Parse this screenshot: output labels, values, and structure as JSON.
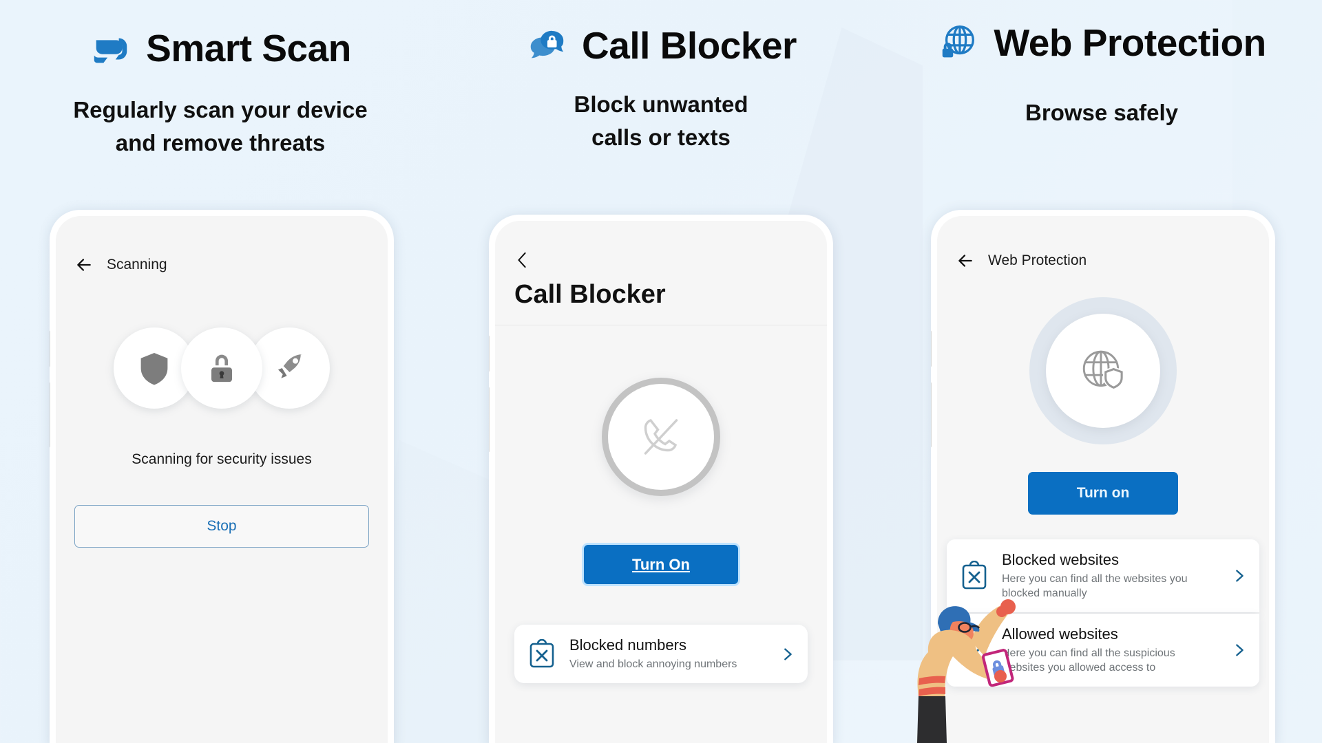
{
  "theme": {
    "page_bg": "#eaf4fc",
    "brand_blue": "#0a6fc2",
    "icon_blue": "#1f7bc4",
    "link_blue": "#1a6fb5",
    "heading_black": "#0a0a0a",
    "muted_gray": "#6f7478",
    "phone_screen": "#f5f5f5"
  },
  "panels": [
    {
      "id": "smart-scan",
      "header": {
        "icon": "smart-scan-icon",
        "title": "Smart Scan"
      },
      "subtitle": "Regularly scan your device and remove threats",
      "subtitle_lines": [
        "Regularly scan your device",
        "and remove threats"
      ],
      "phone": {
        "nav": {
          "back_icon": "arrow-left-icon",
          "title": "Scanning"
        },
        "status_icons": [
          "shield-icon",
          "lock-icon",
          "rocket-icon"
        ],
        "status_text": "Scanning for security issues",
        "primary_button": {
          "label": "Stop",
          "style": "outline"
        }
      }
    },
    {
      "id": "call-blocker",
      "header": {
        "icon": "chat-lock-icon",
        "title": "Call Blocker"
      },
      "subtitle": "Block unwanted calls or texts",
      "subtitle_lines": [
        "Block unwanted",
        "calls or texts"
      ],
      "phone": {
        "nav": {
          "back_icon": "chevron-left-icon"
        },
        "screen_title": "Call Blocker",
        "center_icon": "phone-off-icon",
        "primary_button": {
          "label": "Turn On",
          "style": "solid"
        },
        "list": [
          {
            "icon": "clipboard-x-icon",
            "title": "Blocked numbers",
            "desc": "View and block annoying numbers",
            "chevron": "chevron-right-icon"
          }
        ]
      }
    },
    {
      "id": "web-protection",
      "header": {
        "icon": "globe-lock-icon",
        "title": "Web Protection"
      },
      "subtitle": "Browse safely",
      "subtitle_lines": [
        "Browse safely"
      ],
      "phone": {
        "nav": {
          "back_icon": "arrow-left-icon",
          "title": "Web Protection"
        },
        "center_icon": "globe-shield-icon",
        "primary_button": {
          "label": "Turn on",
          "style": "solid"
        },
        "list": [
          {
            "icon": "clipboard-x-icon",
            "title": "Blocked websites",
            "desc": "Here you can find all the websites you blocked manually",
            "chevron": "chevron-right-icon"
          },
          {
            "icon": "clipboard-check-icon",
            "title": "Allowed websites",
            "desc": "Here you can find all the suspicious websites you allowed access to",
            "chevron": "chevron-right-icon"
          }
        ]
      }
    }
  ],
  "illustration": {
    "name": "person-holding-phone-illustration",
    "colors": {
      "cap": "#2f6fb5",
      "skin": "#f0825e",
      "sweater": "#efc083",
      "stripe": "#e8604e",
      "pants": "#2d2d2f",
      "device": "#e05c9a"
    }
  }
}
